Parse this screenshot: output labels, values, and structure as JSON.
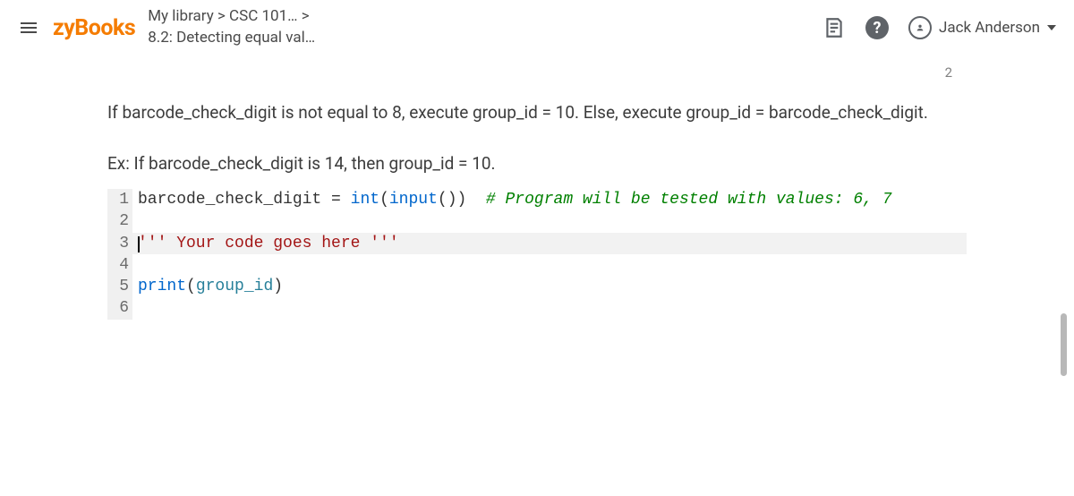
{
  "header": {
    "logo": "zyBooks",
    "breadcrumb_line1": "My library > CSC 101… >",
    "breadcrumb_line2": "8.2: Detecting equal val…",
    "user_name": "Jack Anderson"
  },
  "page_indicator": "2",
  "content": {
    "instruction": "If barcode_check_digit is not equal to 8, execute group_id = 10. Else, execute group_id = barcode_check_digit.",
    "example": "Ex: If barcode_check_digit is 14, then group_id = 10."
  },
  "code": {
    "lines": [
      {
        "num": "1",
        "tokens": [
          {
            "cls": "plain",
            "text": "barcode_check_digit "
          },
          {
            "cls": "plain",
            "text": "= "
          },
          {
            "cls": "kw-func",
            "text": "int"
          },
          {
            "cls": "plain",
            "text": "("
          },
          {
            "cls": "kw-func",
            "text": "input"
          },
          {
            "cls": "plain",
            "text": "())  "
          },
          {
            "cls": "kw-comment",
            "text": "# Program will be tested with values: 6, 7"
          }
        ]
      },
      {
        "num": "2",
        "tokens": []
      },
      {
        "num": "3",
        "highlight": true,
        "cursor": true,
        "tokens": [
          {
            "cls": "kw-str",
            "text": "''' Your code goes here '''"
          }
        ]
      },
      {
        "num": "4",
        "tokens": []
      },
      {
        "num": "5",
        "tokens": [
          {
            "cls": "kw-func",
            "text": "print"
          },
          {
            "cls": "plain",
            "text": "("
          },
          {
            "cls": "kw-ident",
            "text": "group_id"
          },
          {
            "cls": "plain",
            "text": ")"
          }
        ]
      },
      {
        "num": "6",
        "tokens": []
      }
    ]
  }
}
